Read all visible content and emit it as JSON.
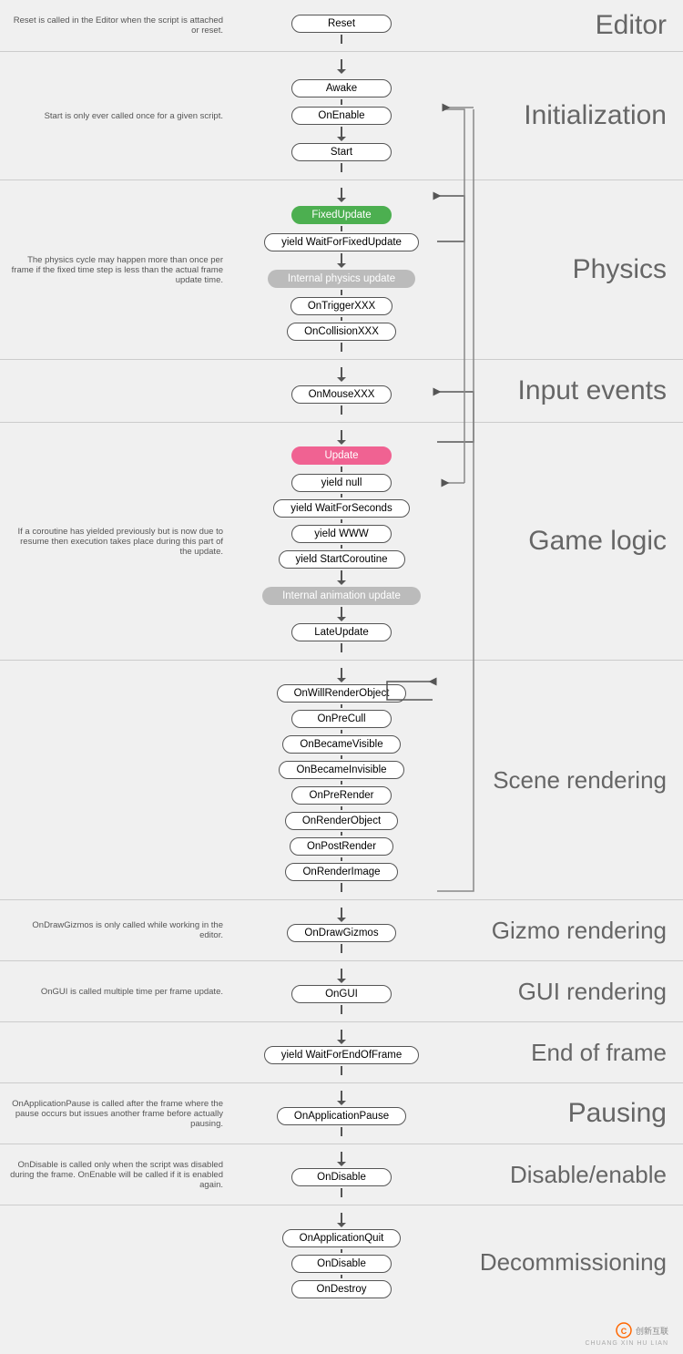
{
  "sections": {
    "editor": {
      "label": "Editor",
      "description": "Reset is called in the Editor when the script is attached or reset.",
      "nodes": [
        "Reset"
      ]
    },
    "initialization": {
      "label": "Initialization",
      "description": "Start is only ever called once for a given script.",
      "nodes": [
        "Awake",
        "OnEnable",
        "Start"
      ]
    },
    "physics": {
      "label": "Physics",
      "description": "The physics cycle may happen more than once per frame if the fixed time step is less than the actual frame update time.",
      "nodes": [
        "FixedUpdate",
        "yield WaitForFixedUpdate",
        "Internal physics update",
        "OnTriggerXXX",
        "OnCollisionXXX"
      ]
    },
    "input": {
      "label": "Input events",
      "description": "",
      "nodes": [
        "OnMouseXXX"
      ]
    },
    "gamelogic": {
      "label": "Game logic",
      "description": "If a coroutine has yielded previously but is now due to resume then execution takes place during this part of the update.",
      "nodes": [
        "Update",
        "yield null",
        "yield WaitForSeconds",
        "yield WWW",
        "yield StartCoroutine",
        "Internal animation update",
        "LateUpdate"
      ]
    },
    "scene": {
      "label": "Scene rendering",
      "description": "",
      "nodes": [
        "OnWillRenderObject",
        "OnPreCull",
        "OnBecameVisible",
        "OnBecameInvisible",
        "OnPreRender",
        "OnRenderObject",
        "OnPostRender",
        "OnRenderImage"
      ]
    },
    "gizmo": {
      "label": "Gizmo rendering",
      "description": "OnDrawGizmos is only called while working in the editor.",
      "nodes": [
        "OnDrawGizmos"
      ]
    },
    "gui": {
      "label": "GUI rendering",
      "description": "OnGUI is called multiple time per frame update.",
      "nodes": [
        "OnGUI"
      ]
    },
    "eof": {
      "label": "End of frame",
      "description": "",
      "nodes": [
        "yield WaitForEndOfFrame"
      ]
    },
    "pausing": {
      "label": "Pausing",
      "description": "OnApplicationPause is called after the frame where the pause occurs but issues another frame before actually pausing.",
      "nodes": [
        "OnApplicationPause"
      ]
    },
    "disable": {
      "label": "Disable/enable",
      "description": "OnDisable is called only when the script was disabled during the frame. OnEnable will be called if it is enabled again.",
      "nodes": [
        "OnDisable"
      ]
    },
    "decommissioning": {
      "label": "Decommissioning",
      "description": "",
      "nodes": [
        "OnApplicationQuit",
        "OnDisable",
        "OnDestroy"
      ]
    }
  },
  "watermark": {
    "line1": "创新互联",
    "line2": "CHUANG XIN HU LIAN"
  }
}
